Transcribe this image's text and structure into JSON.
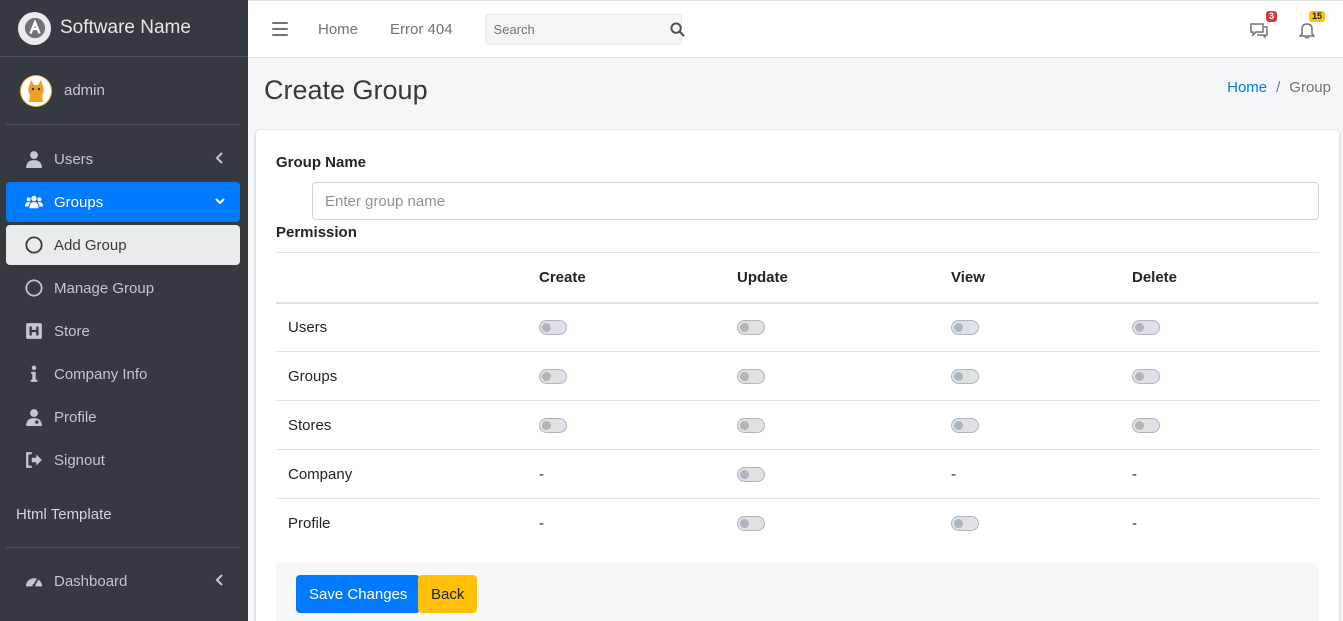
{
  "brand": {
    "name": "Software Name"
  },
  "user": {
    "name": "admin"
  },
  "sidebar": {
    "items": [
      {
        "label": "Users"
      },
      {
        "label": "Groups"
      },
      {
        "label": "Add Group"
      },
      {
        "label": "Manage Group"
      },
      {
        "label": "Store"
      },
      {
        "label": "Company Info"
      },
      {
        "label": "Profile"
      },
      {
        "label": "Signout"
      }
    ],
    "header": "Html Template",
    "dashboard": "Dashboard"
  },
  "topbar": {
    "links": [
      "Home",
      "Error 404"
    ],
    "search_placeholder": "Search",
    "messages_count": "3",
    "notifications_count": "15"
  },
  "page": {
    "title": "Create Group",
    "breadcrumb": [
      "Home",
      "Group"
    ]
  },
  "form": {
    "group_name_label": "Group Name",
    "group_name_placeholder": "Enter group name",
    "group_name_value": "",
    "permission_label": "Permission",
    "columns": [
      "",
      "Create",
      "Update",
      "View",
      "Delete"
    ],
    "rows": [
      {
        "name": "Users",
        "create": "toggle",
        "update": "toggle",
        "view": "toggle",
        "delete": "toggle"
      },
      {
        "name": "Groups",
        "create": "toggle",
        "update": "toggle",
        "view": "toggle",
        "delete": "toggle"
      },
      {
        "name": "Stores",
        "create": "toggle",
        "update": "toggle",
        "view": "toggle",
        "delete": "toggle"
      },
      {
        "name": "Company",
        "create": "-",
        "update": "toggle",
        "view": "-",
        "delete": "-"
      },
      {
        "name": "Profile",
        "create": "-",
        "update": "toggle",
        "view": "toggle",
        "delete": "-"
      }
    ],
    "toggle_state": "off",
    "save_label": "Save Changes",
    "back_label": "Back"
  },
  "colors": {
    "sidebar_bg": "#343a40",
    "primary": "#007bff",
    "warning": "#ffc107",
    "danger": "#dc3545"
  }
}
